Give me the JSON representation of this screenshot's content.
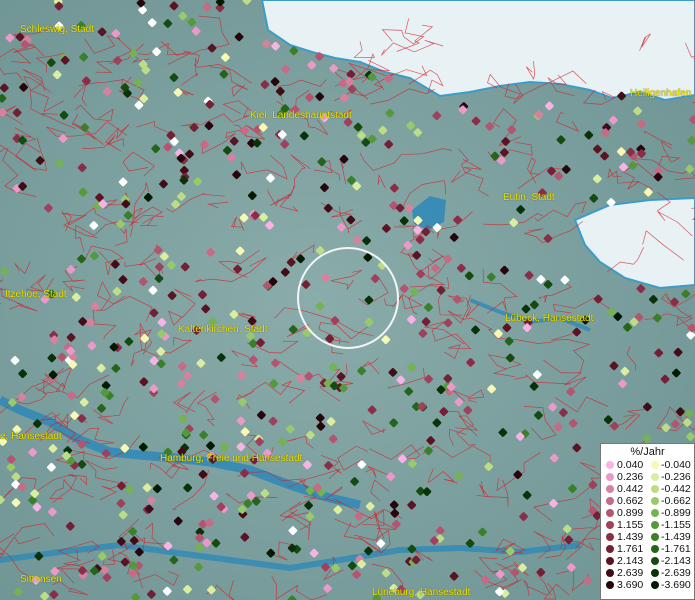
{
  "cities": [
    {
      "id": "schleswig",
      "name": "Schleswig, Stadt"
    },
    {
      "id": "kiel",
      "name": "Kiel, Landeshauptstadt"
    },
    {
      "id": "heiligenhafen",
      "name": "Heiligenhafen"
    },
    {
      "id": "eutin",
      "name": "Eutin, Stadt"
    },
    {
      "id": "itzehoe",
      "name": "Itzehoe, Stadt"
    },
    {
      "id": "kaltenkirchen",
      "name": "Kaltenkirchen, Stadt"
    },
    {
      "id": "luebeck",
      "name": "Lübeck, Hansestadt"
    },
    {
      "id": "hamburg-west",
      "name": "e, Hansestadt"
    },
    {
      "id": "hamburg",
      "name": "Hamburg, Freie und Hansestadt"
    },
    {
      "id": "sittensen",
      "name": "Sittensen"
    },
    {
      "id": "lueneburg",
      "name": "Lüneburg, Hansestadt"
    }
  ],
  "legend": {
    "title": "%/Jahr",
    "positive": [
      {
        "value": "0.040",
        "color": "#f7b3e3"
      },
      {
        "value": "0.236",
        "color": "#ea99c8"
      },
      {
        "value": "0.442",
        "color": "#d9809f"
      },
      {
        "value": "0.662",
        "color": "#c66a85"
      },
      {
        "value": "0.899",
        "color": "#b45570"
      },
      {
        "value": "1.155",
        "color": "#9f405c"
      },
      {
        "value": "1.439",
        "color": "#8a2e47"
      },
      {
        "value": "1.761",
        "color": "#731f34"
      },
      {
        "value": "2.143",
        "color": "#5a1423"
      },
      {
        "value": "2.639",
        "color": "#420c16"
      },
      {
        "value": "3.690",
        "color": "#26060b"
      }
    ],
    "negative": [
      {
        "value": "-0.040",
        "color": "#f5f9b3"
      },
      {
        "value": "-0.236",
        "color": "#dbeea0"
      },
      {
        "value": "-0.442",
        "color": "#bcdd86"
      },
      {
        "value": "-0.662",
        "color": "#98c96b"
      },
      {
        "value": "-0.899",
        "color": "#74b252"
      },
      {
        "value": "-1.155",
        "color": "#54993b"
      },
      {
        "value": "-1.439",
        "color": "#3a7f29"
      },
      {
        "value": "-1.761",
        "color": "#25641b"
      },
      {
        "value": "-2.143",
        "color": "#154b10"
      },
      {
        "value": "-2.639",
        "color": "#093208"
      },
      {
        "value": "-3.690",
        "color": "#021a02"
      }
    ]
  },
  "colors": {
    "land": "#7fa3a0",
    "water": "#2e88b8",
    "boundary": "#d3202a",
    "label": "#f0e400",
    "highlight": "#ffffff"
  }
}
